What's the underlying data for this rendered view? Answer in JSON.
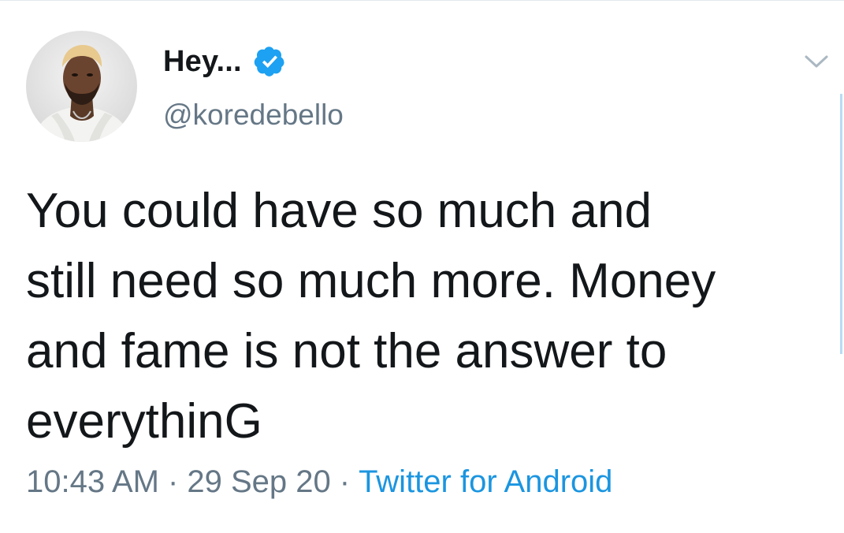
{
  "user": {
    "display_name": "Hey...",
    "handle": "@koredebello",
    "verified": true
  },
  "tweet": {
    "text": "You could have so much and\nstill need so much more. Money\nand fame is not the answer to\neverythinG",
    "time": "10:43 AM",
    "date": "29 Sep 20",
    "separator": "·",
    "source": "Twitter for Android"
  },
  "icons": {
    "verified": "verified-badge-icon",
    "menu": "chevron-down-icon"
  },
  "colors": {
    "text": "#14171a",
    "secondary": "#657786",
    "link": "#1b95e0",
    "verified": "#1da1f2"
  }
}
